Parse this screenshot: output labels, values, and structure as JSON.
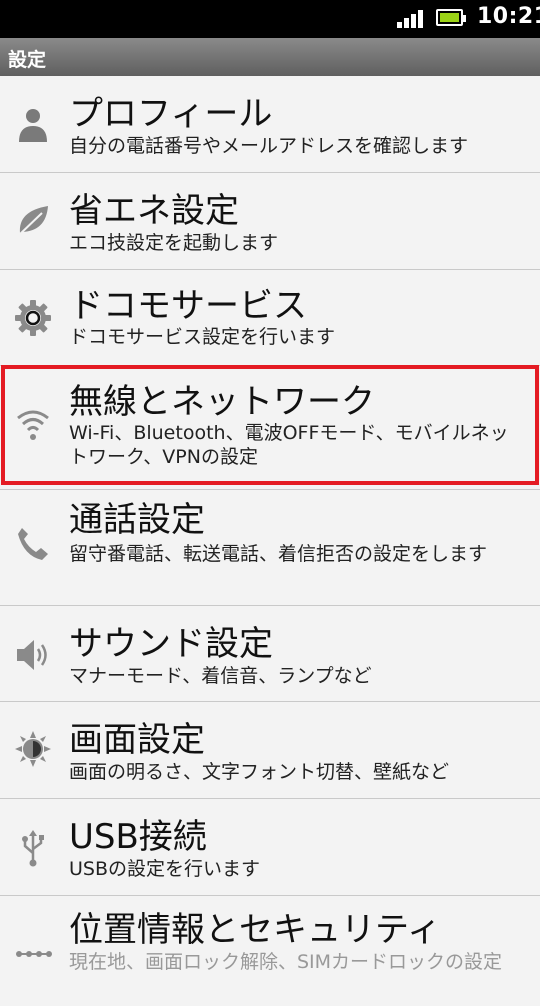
{
  "status": {
    "time": "10:21",
    "battery_color": "#9cd317"
  },
  "header": {
    "title": "設定"
  },
  "items": [
    {
      "icon": "person-icon",
      "title": "プロフィール",
      "desc": "自分の電話番号やメールアドレスを確認します"
    },
    {
      "icon": "leaf-icon",
      "title": "省エネ設定",
      "desc": "エコ技設定を起動します"
    },
    {
      "icon": "gear-icon",
      "title": "ドコモサービス",
      "desc": "ドコモサービス設定を行います"
    },
    {
      "icon": "wifi-icon",
      "title": "無線とネットワーク",
      "desc": "Wi-Fi、Bluetooth、電波OFFモード、モバイルネットワーク、VPNの設定"
    },
    {
      "icon": "phone-icon",
      "title": "通話設定",
      "desc": "留守番電話、転送電話、着信拒否の設定をします"
    },
    {
      "icon": "speaker-icon",
      "title": "サウンド設定",
      "desc": "マナーモード、着信音、ランプなど"
    },
    {
      "icon": "brightness-icon",
      "title": "画面設定",
      "desc": "画面の明るさ、文字フォント切替、壁紙など"
    },
    {
      "icon": "usb-icon",
      "title": "USB接続",
      "desc": "USBの設定を行います"
    },
    {
      "icon": "location-icon",
      "title": "位置情報とセキュリティ",
      "desc": "現在地、画面ロック解除、SIMカードロックの設定"
    }
  ],
  "highlight_color": "#e41b23"
}
